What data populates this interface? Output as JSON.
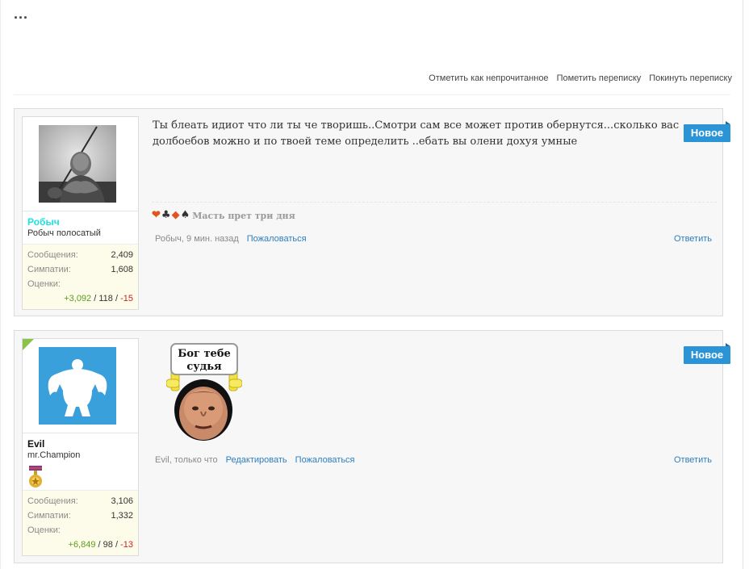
{
  "top": {
    "more_icon": "more-dots-icon",
    "more_glyph": "..."
  },
  "actions": {
    "mark_unread": "Отметить как непрочитанное",
    "star": "Пометить переписку",
    "leave": "Покинуть переписку"
  },
  "messages": [
    {
      "username": "Робыч",
      "user_title": "Робыч полосатый",
      "stats": {
        "messages_label": "Сообщения:",
        "messages": "2,409",
        "likes_label": "Симпатии:",
        "likes": "1,608",
        "ratings_label": "Оценки:",
        "ratings_positive": "+3,092",
        "ratings_neutral": "118",
        "ratings_negative": "-15",
        "separator": "/"
      },
      "new_badge": "Новое",
      "text": "Ты блеать идиот что ли ты че творишь..Смотри сам все может против обернутся...сколько вас долбоебов можно и по твоей теме определить ..ебать вы олени дохуя умные",
      "signature": {
        "suits": [
          "❤",
          "♣",
          "◆",
          "♠"
        ],
        "text": "Масть прет три дня"
      },
      "meta": {
        "author_time": "Робыч, 9 мин. назад",
        "report": "Пожаловаться",
        "reply": "Ответить"
      }
    },
    {
      "username": "Evil",
      "user_title": "mr.Champion",
      "stats": {
        "messages_label": "Сообщения:",
        "messages": "3,106",
        "likes_label": "Симпатии:",
        "likes": "1,332",
        "ratings_label": "Оценки:",
        "ratings_positive": "+6,849",
        "ratings_neutral": "98",
        "ratings_negative": "-13",
        "separator": "/"
      },
      "new_badge": "Новое",
      "sticker_text": [
        "Бог тебе",
        "судья"
      ],
      "meta": {
        "author_time": "Evil, только что",
        "edit": "Редактировать",
        "report": "Пожаловаться",
        "reply": "Ответить"
      }
    }
  ],
  "colors": {
    "accent": "#2b94d6",
    "link": "#2b7fc1",
    "username_1": "#1ee0e0",
    "positive": "#5a9e1c",
    "negative": "#cc2222"
  }
}
